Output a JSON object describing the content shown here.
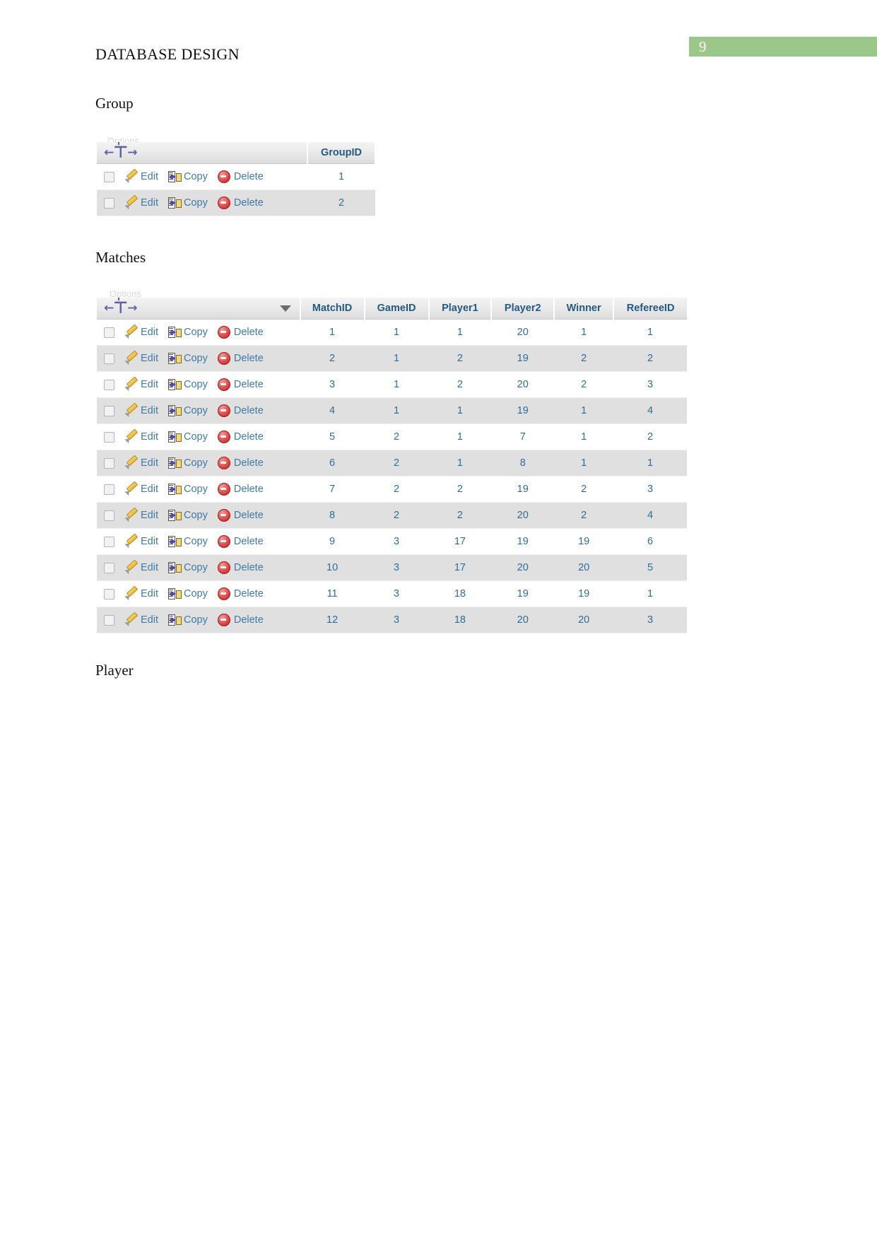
{
  "page": {
    "badge_number": "9",
    "badge_color": "#9cc78a",
    "title": "DATABASE DESIGN"
  },
  "headings": {
    "group": "Group",
    "matches": "Matches",
    "player": "Player"
  },
  "actions": {
    "edit": "Edit",
    "copy": "Copy",
    "delete": "Delete",
    "options_ghost": "Options"
  },
  "group_table": {
    "columns": [
      "GroupID"
    ],
    "rows": [
      {
        "GroupID": "1"
      },
      {
        "GroupID": "2"
      }
    ]
  },
  "matches_table": {
    "columns": [
      "MatchID",
      "GameID",
      "Player1",
      "Player2",
      "Winner",
      "RefereeID"
    ],
    "rows": [
      {
        "MatchID": "1",
        "GameID": "1",
        "Player1": "1",
        "Player2": "20",
        "Winner": "1",
        "RefereeID": "1"
      },
      {
        "MatchID": "2",
        "GameID": "1",
        "Player1": "2",
        "Player2": "19",
        "Winner": "2",
        "RefereeID": "2"
      },
      {
        "MatchID": "3",
        "GameID": "1",
        "Player1": "2",
        "Player2": "20",
        "Winner": "2",
        "RefereeID": "3"
      },
      {
        "MatchID": "4",
        "GameID": "1",
        "Player1": "1",
        "Player2": "19",
        "Winner": "1",
        "RefereeID": "4"
      },
      {
        "MatchID": "5",
        "GameID": "2",
        "Player1": "1",
        "Player2": "7",
        "Winner": "1",
        "RefereeID": "2"
      },
      {
        "MatchID": "6",
        "GameID": "2",
        "Player1": "1",
        "Player2": "8",
        "Winner": "1",
        "RefereeID": "1"
      },
      {
        "MatchID": "7",
        "GameID": "2",
        "Player1": "2",
        "Player2": "19",
        "Winner": "2",
        "RefereeID": "3"
      },
      {
        "MatchID": "8",
        "GameID": "2",
        "Player1": "2",
        "Player2": "20",
        "Winner": "2",
        "RefereeID": "4"
      },
      {
        "MatchID": "9",
        "GameID": "3",
        "Player1": "17",
        "Player2": "19",
        "Winner": "19",
        "RefereeID": "6"
      },
      {
        "MatchID": "10",
        "GameID": "3",
        "Player1": "17",
        "Player2": "20",
        "Winner": "20",
        "RefereeID": "5"
      },
      {
        "MatchID": "11",
        "GameID": "3",
        "Player1": "18",
        "Player2": "19",
        "Winner": "19",
        "RefereeID": "1"
      },
      {
        "MatchID": "12",
        "GameID": "3",
        "Player1": "18",
        "Player2": "20",
        "Winner": "20",
        "RefereeID": "3"
      }
    ]
  }
}
